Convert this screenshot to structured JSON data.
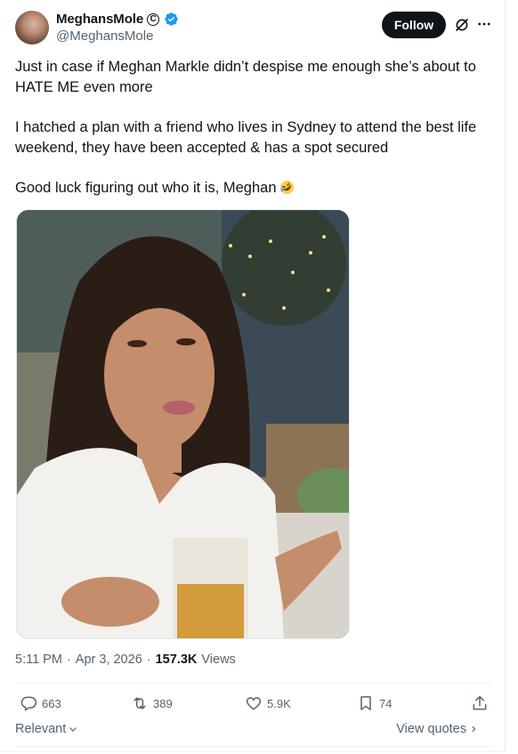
{
  "author": {
    "display_name": "MeghansMole",
    "badge_glyph": "C",
    "handle": "@MeghansMole",
    "avatar_icon": "avatar-photo"
  },
  "header": {
    "follow_label": "Follow",
    "grok_icon": "grok-icon",
    "more_icon": "more-dots-icon"
  },
  "tweet": {
    "paragraph1": "Just in case if Meghan Markle didn’t despise me enough she’s about to HATE ME even more",
    "paragraph2": "I hatched a plan with a friend who lives in Sydney to attend the best life weekend, they have been accepted & has a spot secured",
    "paragraph3": "Good luck figuring out who it is, Meghan",
    "emoji": "rolling-on-floor-laughing-emoji"
  },
  "meta": {
    "time": "5:11 PM",
    "date": "Apr 3, 2026",
    "views_count": "157.3K",
    "views_label": "Views",
    "separator": "·"
  },
  "actions": {
    "replies": "663",
    "reposts": "389",
    "likes": "5.9K",
    "bookmarks": "74"
  },
  "footer": {
    "sort_label": "Relevant",
    "view_quotes_label": "View quotes"
  },
  "colors": {
    "text": "#0f1419",
    "secondary": "#536471",
    "verified": "#1d9bf0",
    "follow_bg": "#0f1419"
  }
}
